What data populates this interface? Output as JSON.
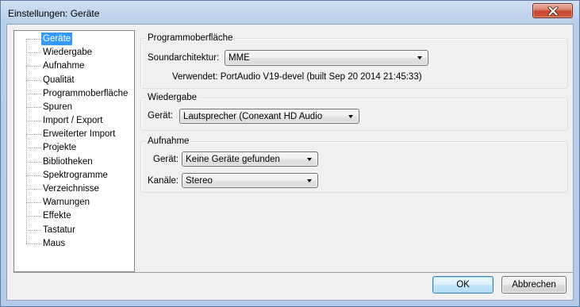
{
  "window": {
    "title": "Einstellungen: Geräte"
  },
  "tree": {
    "selected_index": 0,
    "items": [
      {
        "label": "Geräte"
      },
      {
        "label": "Wiedergabe"
      },
      {
        "label": "Aufnahme"
      },
      {
        "label": "Qualität"
      },
      {
        "label": "Programmoberfläche"
      },
      {
        "label": "Spuren"
      },
      {
        "label": "Import / Export"
      },
      {
        "label": "Erweiterter Import"
      },
      {
        "label": "Projekte"
      },
      {
        "label": "Bibliotheken"
      },
      {
        "label": "Spektrogramme"
      },
      {
        "label": "Verzeichnisse"
      },
      {
        "label": "Warnungen"
      },
      {
        "label": "Effekte"
      },
      {
        "label": "Tastatur"
      },
      {
        "label": "Maus"
      }
    ]
  },
  "interface": {
    "title": "Programmoberfläche",
    "host_label": "Soundarchitektur:",
    "host_value": "MME",
    "using_text": "Verwendet: PortAudio V19-devel (built Sep 20 2014 21:45:33)"
  },
  "playback": {
    "title": "Wiedergabe",
    "device_label": "Gerät:",
    "device_value": "Lautsprecher (Conexant HD Audio"
  },
  "recording": {
    "title": "Aufnahme",
    "device_label": "Gerät:",
    "device_value": "Keine Geräte gefunden",
    "channels_label": "Kanäle:",
    "channels_value": "Stereo"
  },
  "buttons": {
    "ok_label": "OK",
    "cancel_label": "Abbrechen",
    "default": "ok"
  },
  "icons": {
    "close": "close-icon",
    "dropdown": "chevron-down-icon"
  },
  "colors": {
    "selection": "#3399ff",
    "selection_text": "#ffffff",
    "dialog_background": "#f0f0f0",
    "close_button": "#c7432f",
    "default_button_border": "#3c7fb1"
  }
}
